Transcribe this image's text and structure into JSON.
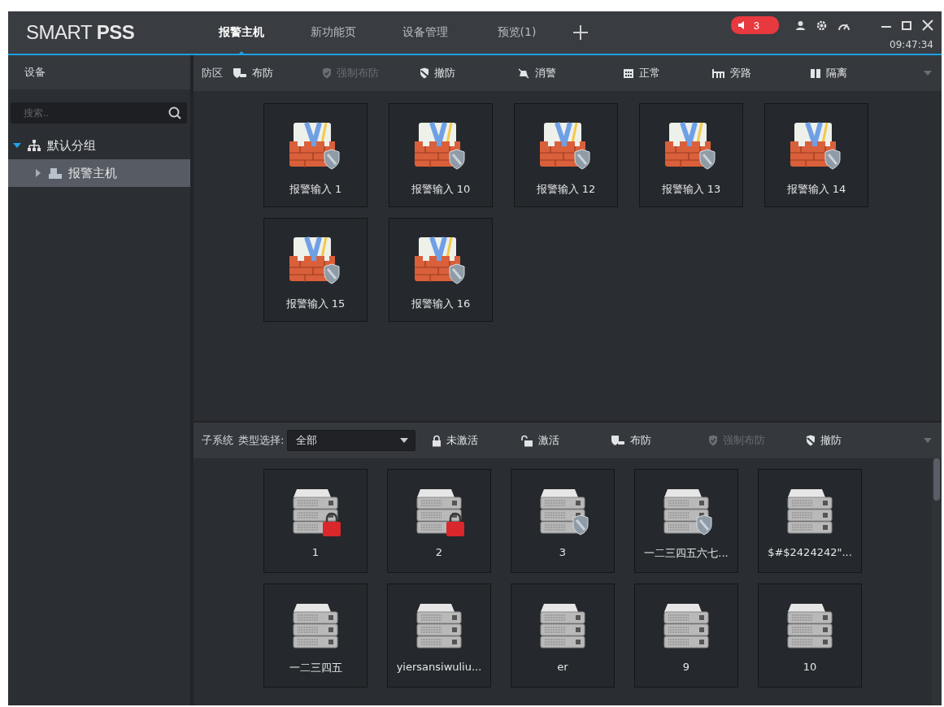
{
  "app_title": "SMART **PSS**",
  "tabs": [
    {
      "label": "报警主机",
      "selected": true
    },
    {
      "label": "新功能页",
      "selected": false
    },
    {
      "label": "设备管理",
      "selected": false
    },
    {
      "label": "预览(1)",
      "selected": false
    }
  ],
  "alarm_count": "3",
  "clock": "09:47:34",
  "sidebar": {
    "title": "设备",
    "search": {
      "placeholder": "搜索.."
    },
    "tree": [
      {
        "label": "默认分组",
        "kind": "group",
        "expanded": true,
        "selected": false,
        "children": [
          {
            "label": "报警主机",
            "kind": "device",
            "expanded": false,
            "selected": true
          }
        ]
      }
    ]
  },
  "zone_toolbar": {
    "label": "防区",
    "actions": [
      {
        "label": "布防",
        "kind": "arm",
        "disabled": false
      },
      {
        "label": "强制布防",
        "kind": "force",
        "disabled": true
      },
      {
        "label": "撤防",
        "kind": "disarm",
        "disabled": false
      },
      {
        "label": "消警",
        "kind": "clear",
        "disabled": false
      },
      {
        "label": "正常",
        "kind": "normal",
        "disabled": false
      },
      {
        "label": "旁路",
        "kind": "bypass",
        "disabled": false
      },
      {
        "label": "隔离",
        "kind": "isolate",
        "disabled": false
      }
    ]
  },
  "zones": [
    {
      "label": "报警输入 1",
      "kind": "armed"
    },
    {
      "label": "报警输入 10",
      "kind": "armed"
    },
    {
      "label": "报警输入 12",
      "kind": "armed"
    },
    {
      "label": "报警输入 13",
      "kind": "armed"
    },
    {
      "label": "报警输入 14",
      "kind": "armed"
    },
    {
      "label": "报警输入 15",
      "kind": "armed"
    },
    {
      "label": "报警输入 16",
      "kind": "armed"
    }
  ],
  "subsystem_toolbar": {
    "label": "子系统",
    "type_label": "类型选择:",
    "type_value": "全部",
    "actions": [
      {
        "label": "未激活",
        "kind": "lock",
        "disabled": false
      },
      {
        "label": "激活",
        "kind": "unlock",
        "disabled": false
      },
      {
        "label": "布防",
        "kind": "arm",
        "disabled": false
      },
      {
        "label": "强制布防",
        "kind": "force",
        "disabled": true
      },
      {
        "label": "撤防",
        "kind": "disarm",
        "disabled": false
      }
    ]
  },
  "subsystems": [
    {
      "label": "1",
      "kind": "locked"
    },
    {
      "label": "2",
      "kind": "locked"
    },
    {
      "label": "3",
      "kind": "armed"
    },
    {
      "label": "一二三四五六七...",
      "kind": "armed"
    },
    {
      "label": "$#$2424242\"...",
      "kind": "plain"
    },
    {
      "label": "一二三四五",
      "kind": "plain"
    },
    {
      "label": "yiersansiwuliu...",
      "kind": "plain"
    },
    {
      "label": "er",
      "kind": "plain"
    },
    {
      "label": "9",
      "kind": "plain"
    },
    {
      "label": "10",
      "kind": "plain"
    }
  ]
}
